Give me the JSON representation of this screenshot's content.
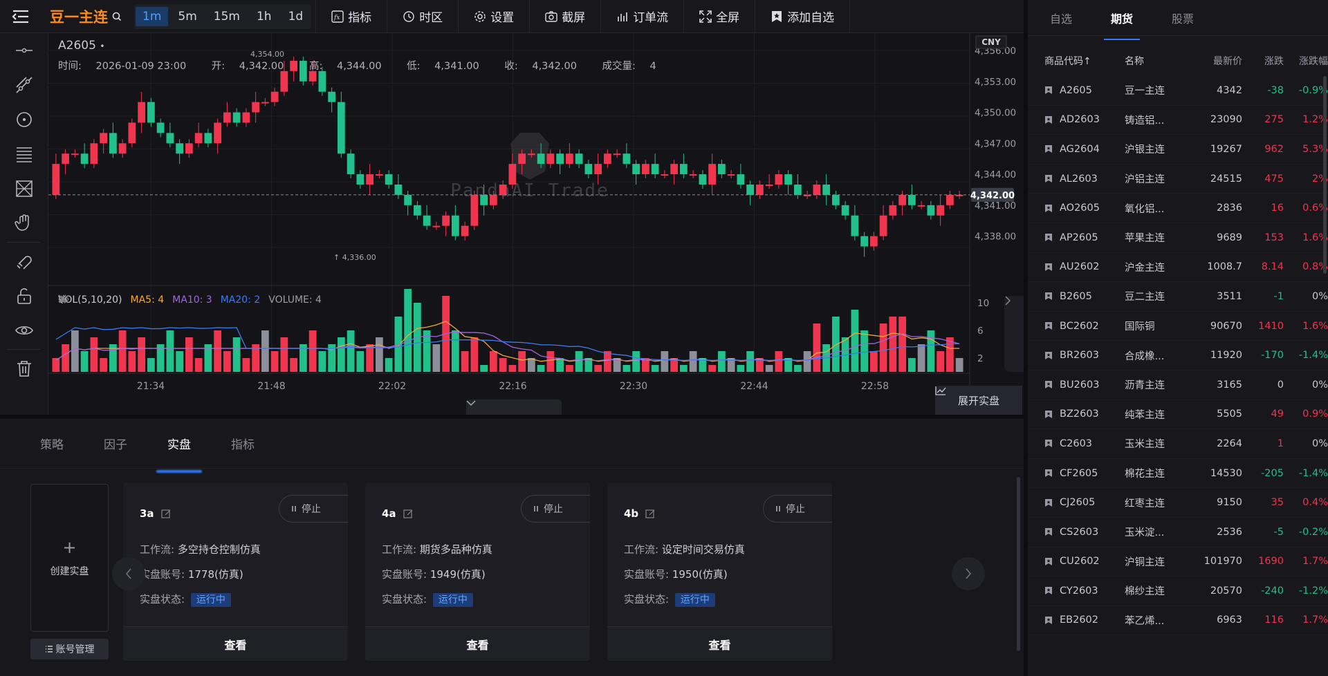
{
  "topbar": {
    "symbol_name": "豆一主连",
    "intervals": [
      "1m",
      "5m",
      "15m",
      "1h",
      "1d"
    ],
    "active_interval": "1m",
    "tools": [
      "指标",
      "时区",
      "设置",
      "截屏",
      "订单流",
      "全屏",
      "添加自选"
    ]
  },
  "chart": {
    "symbol": "A2605",
    "dot": "•",
    "info": {
      "time_label": "时间:",
      "time": "2026-01-09 23:00",
      "open_label": "开:",
      "open": "4,342.00",
      "high_label": "高:",
      "high": "4,344.00",
      "low_label": "低:",
      "low": "4,341.00",
      "close_label": "收:",
      "close": "4,342.00",
      "volume_label": "成交量:",
      "volume": "4"
    },
    "currency": "CNY",
    "watermark": "PandaAI Trade",
    "last_price_label": "4,342.00",
    "high_marker": "4,354.00",
    "low_marker": "4,336.00",
    "price_ticks": [
      "4,356.00",
      "4,353.00",
      "4,350.00",
      "4,347.00",
      "4,344.00",
      "4,341.00",
      "4,338.00"
    ],
    "volume_ticks": [
      "10",
      "6",
      "2"
    ],
    "time_ticks": [
      "21:34",
      "21:48",
      "22:02",
      "22:16",
      "22:30",
      "22:44",
      "22:58"
    ],
    "vol_legend": {
      "title": "VOL(5,10,20)",
      "ma5": "MA5: 4",
      "ma10": "MA10: 3",
      "ma20": "MA20: 2",
      "volume": "VOLUME: 4"
    },
    "colors": {
      "up": "#f0364f",
      "down": "#22c08a",
      "ma5": "#f2a93b",
      "ma10": "#a066e0",
      "ma20": "#3b7cf2"
    }
  },
  "chart_data": {
    "type": "candlestick",
    "x_range": [
      "21:24",
      "23:00"
    ],
    "y_range": [
      4336.5,
      4356
    ],
    "ohlc_sample_last": {
      "open": 4342,
      "high": 4344,
      "low": 4341,
      "close": 4342,
      "volume": 4
    }
  },
  "bottom": {
    "tabs": [
      "策略",
      "因子",
      "实盘",
      "指标"
    ],
    "active_tab": "实盘",
    "create_label": "创建实盘",
    "account_manage_label": "账号管理",
    "cards": [
      {
        "title": "3a",
        "stop": "停止",
        "workflow_label": "工作流:",
        "workflow": "多空持仓控制仿真",
        "account_label": "实盘账号:",
        "account": "1778(仿真)",
        "status_label": "实盘状态:",
        "status": "运行中",
        "view": "查看"
      },
      {
        "title": "4a",
        "stop": "停止",
        "workflow_label": "工作流:",
        "workflow": "期货多品种仿真",
        "account_label": "实盘账号:",
        "account": "1949(仿真)",
        "status_label": "实盘状态:",
        "status": "运行中",
        "view": "查看"
      },
      {
        "title": "4b",
        "stop": "停止",
        "workflow_label": "工作流:",
        "workflow": "设定时间交易仿真",
        "account_label": "实盘账号:",
        "account": "1950(仿真)",
        "status_label": "实盘状态:",
        "status": "运行中",
        "view": "查看"
      }
    ],
    "expand_label": "展开实盘"
  },
  "right": {
    "tabs": [
      "自选",
      "期货",
      "股票"
    ],
    "active_tab": "期货",
    "headers": [
      "商品代码↑",
      "名称",
      "最新价",
      "涨跌",
      "涨跌幅"
    ],
    "rows": [
      {
        "code": "A2605",
        "name": "豆一主连",
        "price": "4342",
        "chg": "-38",
        "pct": "-0.9%",
        "dir": "down"
      },
      {
        "code": "AD2603",
        "name": "铸造铝...",
        "price": "23090",
        "chg": "275",
        "pct": "1.2%",
        "dir": "up"
      },
      {
        "code": "AG2604",
        "name": "沪银主连",
        "price": "19267",
        "chg": "962",
        "pct": "5.3%",
        "dir": "up"
      },
      {
        "code": "AL2603",
        "name": "沪铝主连",
        "price": "24515",
        "chg": "475",
        "pct": "2%",
        "dir": "up"
      },
      {
        "code": "AO2605",
        "name": "氧化铝...",
        "price": "2836",
        "chg": "16",
        "pct": "0.6%",
        "dir": "up"
      },
      {
        "code": "AP2605",
        "name": "苹果主连",
        "price": "9689",
        "chg": "153",
        "pct": "1.6%",
        "dir": "up"
      },
      {
        "code": "AU2602",
        "name": "沪金主连",
        "price": "1008.7",
        "chg": "8.14",
        "pct": "0.8%",
        "dir": "up"
      },
      {
        "code": "B2605",
        "name": "豆二主连",
        "price": "3511",
        "chg": "-1",
        "pct": "0%",
        "dir": "down_flat"
      },
      {
        "code": "BC2602",
        "name": "国际铜",
        "price": "90670",
        "chg": "1410",
        "pct": "1.6%",
        "dir": "up"
      },
      {
        "code": "BR2603",
        "name": "合成橡...",
        "price": "11920",
        "chg": "-170",
        "pct": "-1.4%",
        "dir": "down"
      },
      {
        "code": "BU2603",
        "name": "沥青主连",
        "price": "3165",
        "chg": "0",
        "pct": "0%",
        "dir": "flat"
      },
      {
        "code": "BZ2603",
        "name": "纯苯主连",
        "price": "5505",
        "chg": "49",
        "pct": "0.9%",
        "dir": "up"
      },
      {
        "code": "C2603",
        "name": "玉米主连",
        "price": "2264",
        "chg": "1",
        "pct": "0%",
        "dir": "up_flat"
      },
      {
        "code": "CF2605",
        "name": "棉花主连",
        "price": "14530",
        "chg": "-205",
        "pct": "-1.4%",
        "dir": "down"
      },
      {
        "code": "CJ2605",
        "name": "红枣主连",
        "price": "9150",
        "chg": "35",
        "pct": "0.4%",
        "dir": "up"
      },
      {
        "code": "CS2603",
        "name": "玉米淀...",
        "price": "2536",
        "chg": "-5",
        "pct": "-0.2%",
        "dir": "down"
      },
      {
        "code": "CU2602",
        "name": "沪铜主连",
        "price": "101970",
        "chg": "1690",
        "pct": "1.7%",
        "dir": "up"
      },
      {
        "code": "CY2603",
        "name": "棉纱主连",
        "price": "20570",
        "chg": "-240",
        "pct": "-1.2%",
        "dir": "down"
      },
      {
        "code": "EB2602",
        "name": "苯乙烯...",
        "price": "6963",
        "chg": "116",
        "pct": "1.7%",
        "dir": "up"
      }
    ]
  }
}
